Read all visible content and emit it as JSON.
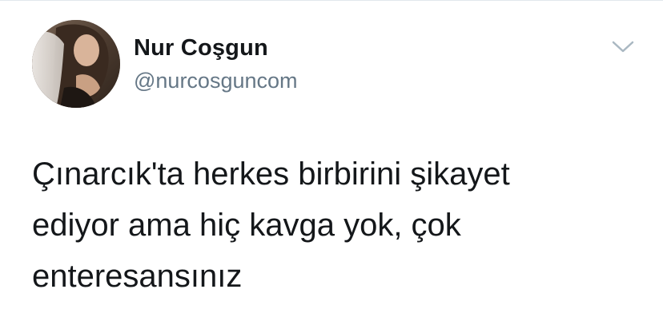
{
  "tweet": {
    "author": {
      "display_name": "Nur Coşgun",
      "handle": "@nurcosguncom",
      "avatar_icon": "profile-photo"
    },
    "menu_icon": "chevron-down-icon",
    "text_lines": [
      "Çınarcık'ta herkes birbirini şikayet",
      "ediyor ama hiç kavga yok, çok",
      "enteresansınız"
    ]
  },
  "colors": {
    "name": "#14171a",
    "handle": "#657786",
    "chevron": "#aab8c2",
    "border": "#e1e8ed"
  }
}
